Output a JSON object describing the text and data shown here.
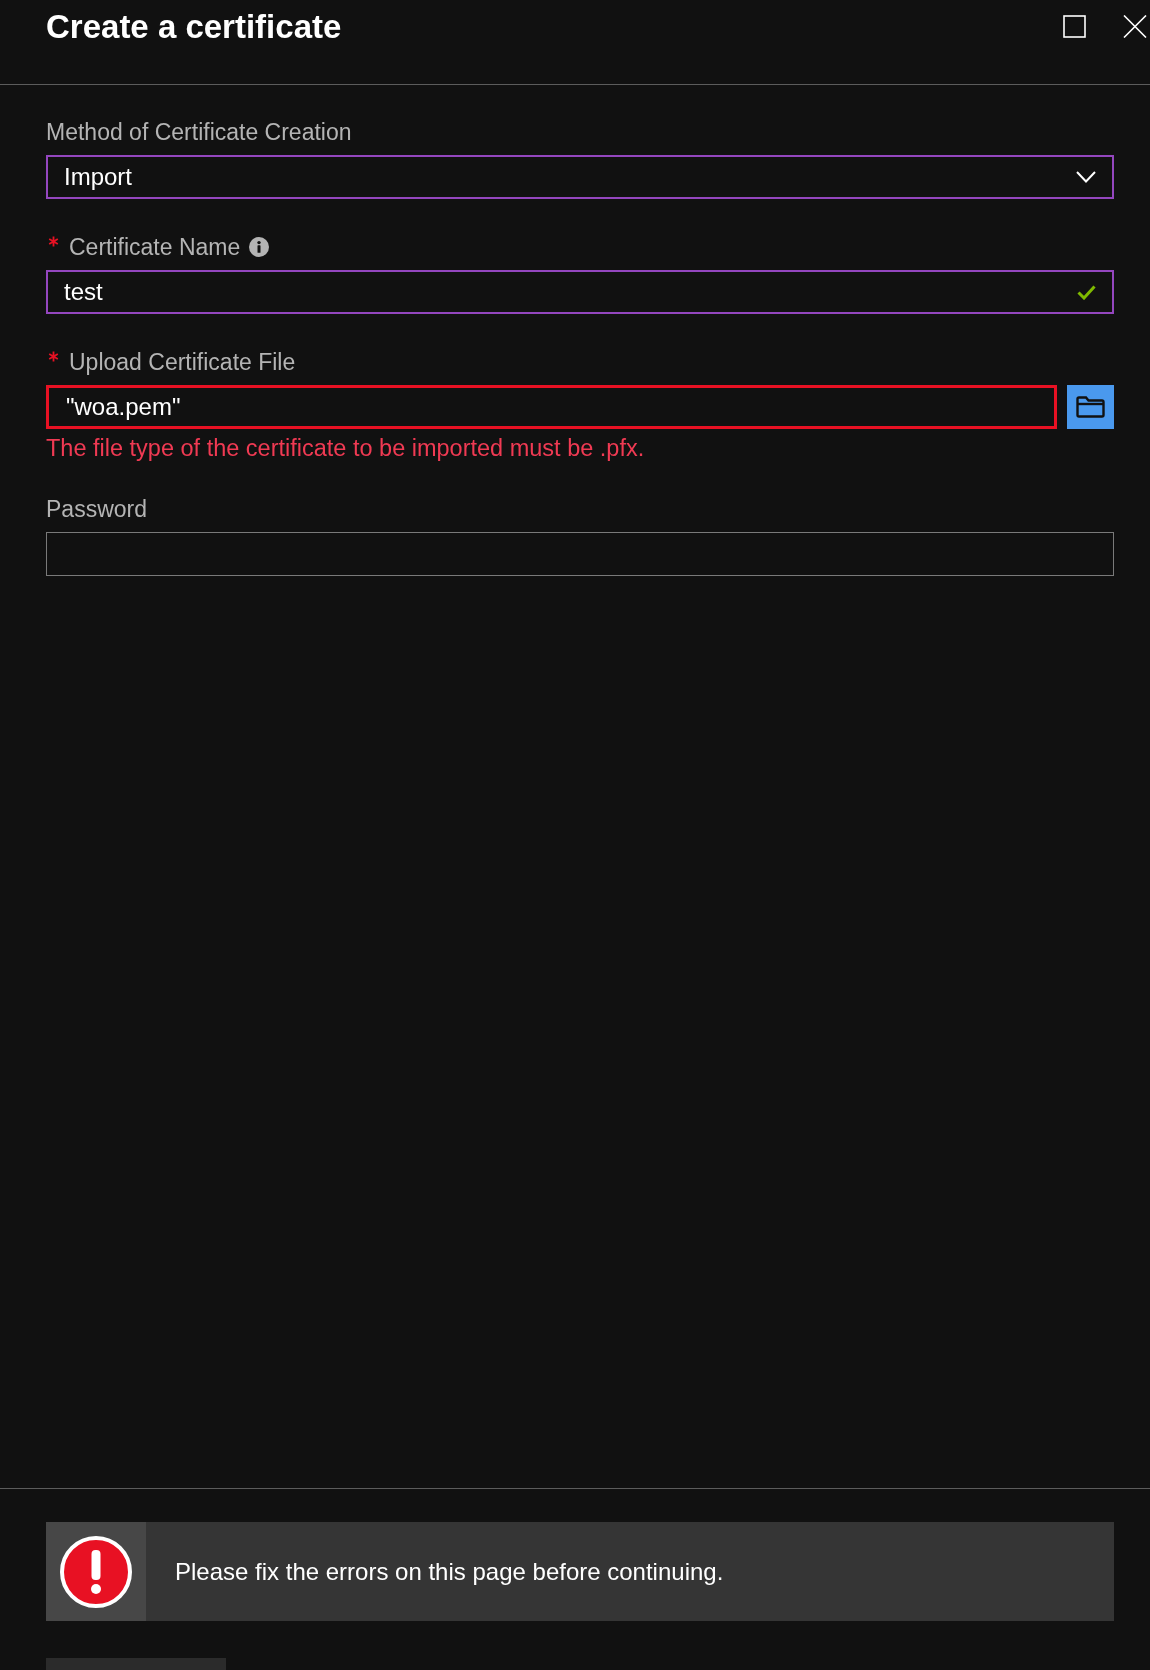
{
  "panel": {
    "title": "Create a certificate"
  },
  "fields": [
    {
      "kind": "dropdown",
      "label": "Method of Certificate Creation",
      "required": false,
      "info": false,
      "highlighted": true,
      "valid": false,
      "invalid": false,
      "value": "Import"
    },
    {
      "kind": "text",
      "label": "Certificate Name",
      "required": true,
      "info": true,
      "highlighted": true,
      "valid": true,
      "invalid": false,
      "value": "test"
    },
    {
      "kind": "file",
      "label": "Upload Certificate File",
      "required": true,
      "info": false,
      "highlighted": false,
      "valid": false,
      "invalid": true,
      "value": "\"woa.pem\"",
      "error": "The file type of the certificate to be imported must be .pfx."
    },
    {
      "kind": "text",
      "label": "Password",
      "required": false,
      "info": false,
      "highlighted": false,
      "valid": false,
      "invalid": false
    }
  ],
  "notification": {
    "kind": "error",
    "message": "Please fix the errors on this page before continuing."
  }
}
